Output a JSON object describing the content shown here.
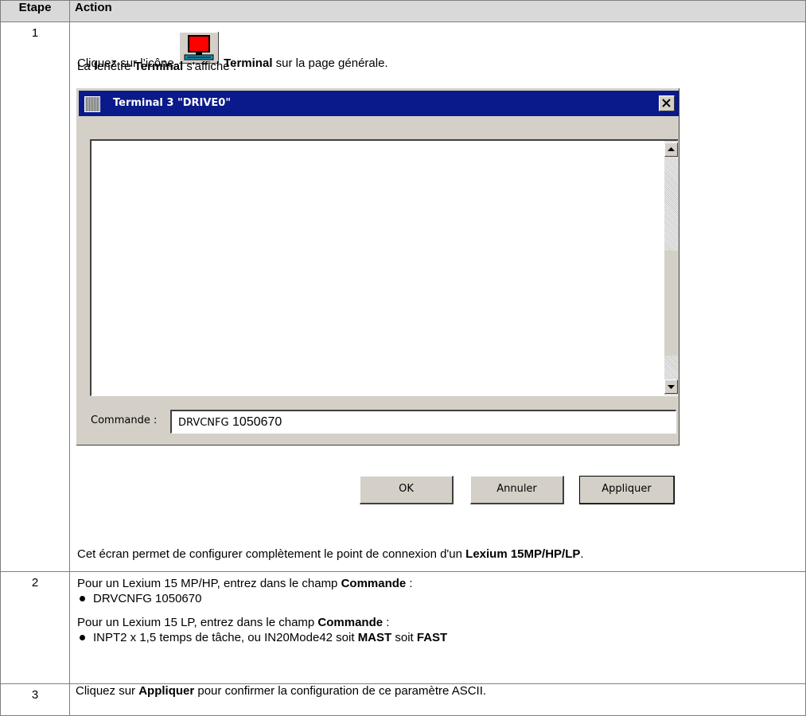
{
  "headers": {
    "step": "Etape",
    "action": "Action"
  },
  "step1": {
    "number": "1",
    "click_prefix": "Cliquez sur l’icône",
    "icon_label": "Terminal",
    "click_suffix": "sur la page générale.",
    "window_prefix": "La fenêtre",
    "window_name": "Terminal",
    "window_suffix": "s'affiche :",
    "dialog": {
      "title": "Terminal 3 \"DRIVE0\"",
      "command_label": "Commande :",
      "command_prefix": "DRVCNFG",
      "command_value": "1050670",
      "buttons": {
        "ok": "OK",
        "cancel": "Annuler",
        "apply": "Appliquer"
      }
    },
    "final_prefix": "Cet écran permet de configurer complètement le point de connexion d'un",
    "final_bold": "Lexium 15MP/HP/LP",
    "final_suffix": "."
  },
  "step2": {
    "number": "2",
    "p1_prefix": "Pour un Lexium 15 MP/HP, entrez dans le champ",
    "p1_bold": "Commande",
    "p1_suffix": " :",
    "bullet1": "DRVCNFG 1050670",
    "p2_prefix": "Pour un Lexium 15 LP, entrez dans le champ",
    "p2_bold": "Commande",
    "p2_suffix": " :",
    "bullet2_prefix": "INPT2 x 1,5 temps de tâche, ou IN20Mode42 soit",
    "bullet2_bold1": "MAST",
    "bullet2_mid": " soit ",
    "bullet2_bold2": "FAST"
  },
  "step3": {
    "number": "3",
    "prefix": "Cliquez sur",
    "bold": "Appliquer",
    "suffix": "pour confirmer la configuration de ce paramètre ASCII."
  }
}
